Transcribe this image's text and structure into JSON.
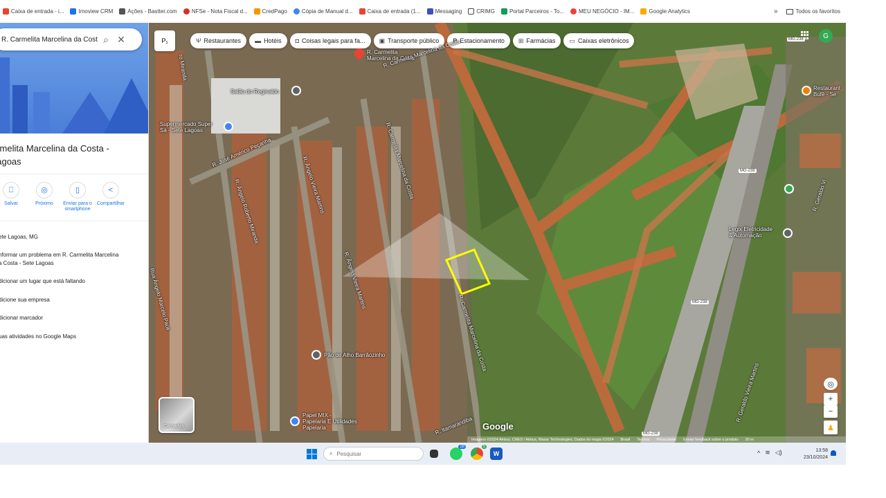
{
  "bookmarks": [
    {
      "label": "Caixa de entrada - i...",
      "color": "#ea4335"
    },
    {
      "label": "Imoview CRM",
      "color": "#1a73e8"
    },
    {
      "label": "Ações - Bastter.com",
      "color": "#555555"
    },
    {
      "label": "NFSe - Nota Fiscal d...",
      "color": "#d93025"
    },
    {
      "label": "CredPago",
      "color": "#f29900"
    },
    {
      "label": "Cópia de Manual d...",
      "color": "#4285f4"
    },
    {
      "label": "Caixa de entrada (1...",
      "color": "#ea4335"
    },
    {
      "label": "Messaging",
      "color": "#3f51b5"
    },
    {
      "label": "CRIMG",
      "color": "#444444"
    },
    {
      "label": "Portal Parceiros - To...",
      "color": "#0f9d58"
    },
    {
      "label": "MEU NEGÓCIO - IM...",
      "color": "#ea4335"
    },
    {
      "label": "Google Analytics",
      "color": "#f9ab00"
    }
  ],
  "bookmarks_more": "»",
  "bookmarks_folder": "Todos os favoritos",
  "search": {
    "value": "R. Carmelita Marcelina da Cost"
  },
  "place": {
    "title": "armelita Marcelina da Costa -\nLagoas"
  },
  "actions": [
    {
      "icon": "bookmark-icon",
      "glyph": "⎕",
      "label": "Salvar"
    },
    {
      "icon": "nearby-icon",
      "glyph": "◎",
      "label": "Próximo"
    },
    {
      "icon": "send-to-phone-icon",
      "glyph": "▯",
      "label": "Enviar para o smartphone"
    },
    {
      "icon": "share-icon",
      "glyph": "<",
      "label": "Compartilhar"
    }
  ],
  "side_items": [
    "ete Lagoas, MG",
    "nformar um problema em R. Carmelita Marcelina\na Costa - Sete Lagoas",
    "dicionar um lugar que está faltando",
    "dicione sua empresa",
    "dicionar marcador",
    "uas atividades no Google Maps"
  ],
  "filters": [
    {
      "icon": "restaurant-icon",
      "glyph": "🍴",
      "label": "Restaurantes"
    },
    {
      "icon": "hotel-icon",
      "glyph": "▬",
      "label": "Hotéis"
    },
    {
      "icon": "camera-icon",
      "glyph": "◘",
      "label": "Coisas legais para fa..."
    },
    {
      "icon": "transit-icon",
      "glyph": "▣",
      "label": "Transporte público"
    },
    {
      "icon": "parking-icon",
      "glyph": "P",
      "label": "Estacionamento"
    },
    {
      "icon": "pharmacy-icon",
      "glyph": "⊞",
      "label": "Farmácias"
    },
    {
      "icon": "atm-icon",
      "glyph": "▭",
      "label": "Caixas eletrônicos"
    }
  ],
  "layer_switch_label": "P₁",
  "map_labels": {
    "pin_label": "R. Carmelita\nMarcelina da Costa",
    "salao": "Salão do Reginaldo",
    "supermercado": "Supermercado Super\nSá - Sete Lagoas",
    "rua_jose": "R. José Américo Peçanha",
    "rua_angelo_vieira_1": "R. Ângelo Vieira Martins",
    "rua_angelo_roberto": "R. Ângelo Roberto Miranda",
    "rua_angelo_vieira_2": "R. Ângelo Vieira Martins",
    "rua_carmelita_1": "R. Carmelita Marcelina da Costa",
    "rua_carmelita_2": "R. Carmelita Marcelina da Costa",
    "rua_angelo_marcelo": "Rua Ângelo Marcelo Paoli",
    "rua_miranda": "ro Miranda",
    "pao": "Pão de Alho Barrãozinho",
    "papel": "Papel MIX -\nPapelaria E Utilidades\nPapelaria",
    "ramarandiba": "R. Itamarandiba",
    "legix": "Legix Eletricidade\n& Automação",
    "restaurante": "Restaurant\nBufê - Se",
    "geraldo_1": "R. Geraldo Vieira Martins",
    "geraldo_2": "R. Geraldo Vi",
    "road_top": "R. Carmelita Marcelina da Costa"
  },
  "road_badges": [
    "MG-238",
    "MG-238",
    "MG-238",
    "MG-238"
  ],
  "avatar_letter": "G",
  "layers_label": "Camadas",
  "google_logo": "Google",
  "attribution": [
    "Imagens ©2024 Airbus, CNES / Airbus, Maxar Technologies, Dados do mapa ©2024",
    "Brasil",
    "Termos",
    "Privacidade",
    "Enviar feedback sobre o produto",
    "20 m"
  ],
  "taskbar": {
    "search_placeholder": "Pesquisar",
    "whatsapp_badge": "28",
    "chrome_badge": "5",
    "time": "13:58",
    "date": "23/10/2024"
  },
  "colors": {
    "accent": "#1a73e8",
    "pin": "#ea4335",
    "highlight": "#ffff00"
  }
}
